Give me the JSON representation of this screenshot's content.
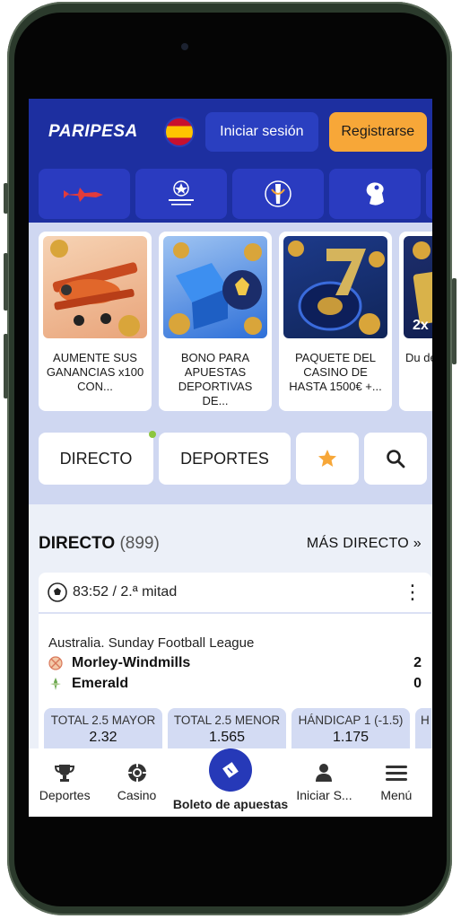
{
  "header": {
    "logo": "PARIPESA",
    "language_flag": "spain-flag-icon",
    "login_label": "Iniciar sesión",
    "register_label": "Registrarse"
  },
  "categories": [
    {
      "icon": "aviator-plane-icon"
    },
    {
      "icon": "champions-league-icon"
    },
    {
      "icon": "europa-league-icon"
    },
    {
      "icon": "premier-league-icon"
    }
  ],
  "promos": [
    {
      "text": "AUMENTE SUS GANANCIAS x100 CON...",
      "image": "orange-airplane-coins"
    },
    {
      "text": "BONO PARA APUESTAS DEPORTIVAS DE...",
      "image": "blue-gift-soccer-ball"
    },
    {
      "text": "PAQUETE DEL CASINO DE HASTA 1500€ +...",
      "image": "roulette-seven-coins"
    },
    {
      "text": "Du de",
      "image": "cards-2x"
    }
  ],
  "nav": {
    "live_label": "DIRECTO",
    "sports_label": "DEPORTES"
  },
  "live_section": {
    "title": "DIRECTO",
    "count": "(899)",
    "more_label": "MÁS DIRECTO »"
  },
  "match": {
    "time": "83:52 / 2.ª mitad",
    "league": "Australia. Sunday Football League",
    "team1": "Morley-Windmills",
    "team2": "Emerald",
    "score1": "2",
    "score2": "0",
    "odds": [
      {
        "label": "TOTAL 2.5 MAYOR",
        "value": "2.32"
      },
      {
        "label": "TOTAL 2.5 MENOR",
        "value": "1.565"
      },
      {
        "label": "HÁNDICAP 1 (-1.5)",
        "value": "1.175"
      },
      {
        "label": "H",
        "value": ""
      }
    ]
  },
  "tabbar": {
    "sports": "Deportes",
    "casino": "Casino",
    "bet_slip": "Boleto de apuestas",
    "login": "Iniciar S...",
    "menu": "Menú"
  },
  "colors": {
    "brand_blue": "#1d2fa0",
    "accent_orange": "#f7a738",
    "background": "#ecf0f8"
  }
}
